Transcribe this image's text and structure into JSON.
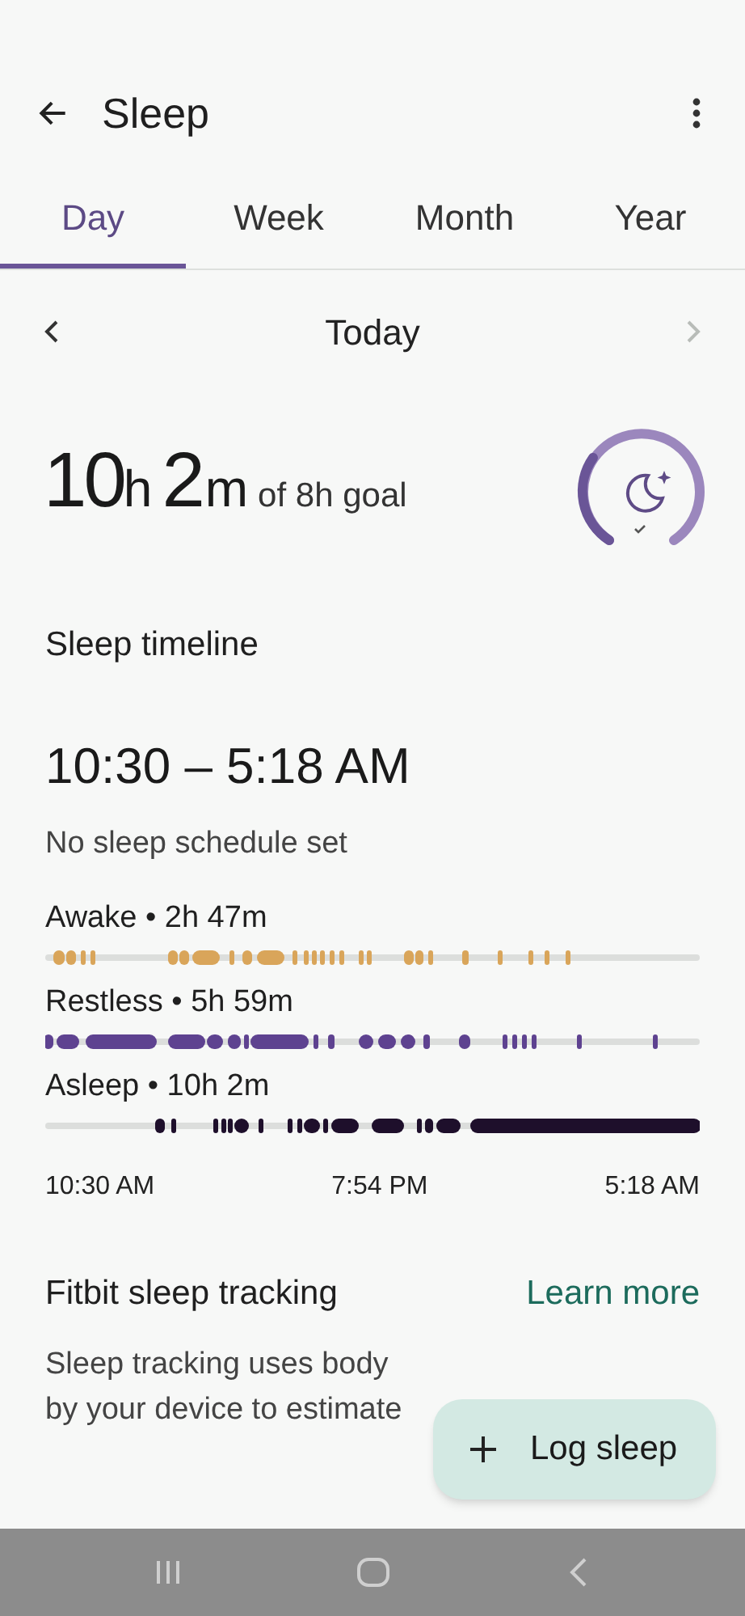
{
  "header": {
    "title": "Sleep"
  },
  "tabs": [
    {
      "label": "Day",
      "selected": true
    },
    {
      "label": "Week",
      "selected": false
    },
    {
      "label": "Month",
      "selected": false
    },
    {
      "label": "Year",
      "selected": false
    }
  ],
  "date_nav": {
    "label": "Today",
    "prev_disabled": false,
    "next_disabled": true
  },
  "summary": {
    "hours": "10",
    "hours_unit": "h",
    "minutes": "2",
    "minutes_unit": "m",
    "goal": "of 8h goal"
  },
  "timeline": {
    "title": "Sleep timeline",
    "range": "10:30 – 5:18 AM",
    "schedule": "No sleep schedule set",
    "stages": [
      {
        "kind": "awake",
        "label": "Awake • 2h 47m",
        "color": "#d9a55a"
      },
      {
        "kind": "restless",
        "label": "Restless • 5h 59m",
        "color": "#5e4290"
      },
      {
        "kind": "asleep",
        "label": "Asleep • 10h 2m",
        "color": "#1e0f2b"
      }
    ],
    "axis": [
      "10:30 AM",
      "7:54 PM",
      "5:18 AM"
    ]
  },
  "tracking": {
    "title": "Fitbit sleep tracking",
    "link": "Learn more",
    "lines": [
      "Sleep tracking uses body",
      "by your device to estimate"
    ]
  },
  "fab": {
    "label": "Log sleep"
  }
}
